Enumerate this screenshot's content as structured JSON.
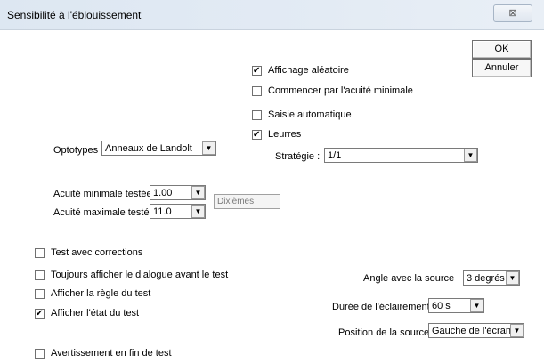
{
  "window": {
    "title": "Sensibilité à l'éblouissement",
    "close_symbol": "⊠"
  },
  "buttons": {
    "ok": "OK",
    "cancel": "Annuler"
  },
  "options": {
    "random_display": {
      "label": "Affichage aléatoire",
      "checked": true
    },
    "start_min_acuity": {
      "label": "Commencer par l'acuité minimale",
      "checked": false
    },
    "auto_entry": {
      "label": "Saisie automatique",
      "checked": false
    },
    "decoys": {
      "label": "Leurres",
      "checked": true
    }
  },
  "strategy": {
    "label": "Stratégie :",
    "value": "1/1"
  },
  "optotypes": {
    "label": "Optotypes :",
    "value": "Anneaux de Landolt"
  },
  "acuity": {
    "min_label": "Acuité minimale testée :",
    "min_value": "1.00",
    "max_label": "Acuité maximale testée :",
    "max_value": "11.0",
    "unit": "Dixièmes"
  },
  "checks": {
    "test_corrections": {
      "label": "Test avec corrections",
      "checked": false
    },
    "always_dialog": {
      "label": "Toujours afficher le dialogue avant le test",
      "checked": false
    },
    "show_rule": {
      "label": "Afficher la règle du test",
      "checked": false
    },
    "show_state": {
      "label": "Afficher l'état du test",
      "checked": true
    },
    "end_warning": {
      "label": "Avertissement en fin de test",
      "checked": false
    }
  },
  "source": {
    "angle_label": "Angle avec la source",
    "angle_value": "3 degrés",
    "duration_label": "Durée de l'éclairement",
    "duration_value": "60 s",
    "position_label": "Position de la source",
    "position_value": "Gauche de l'écran"
  }
}
